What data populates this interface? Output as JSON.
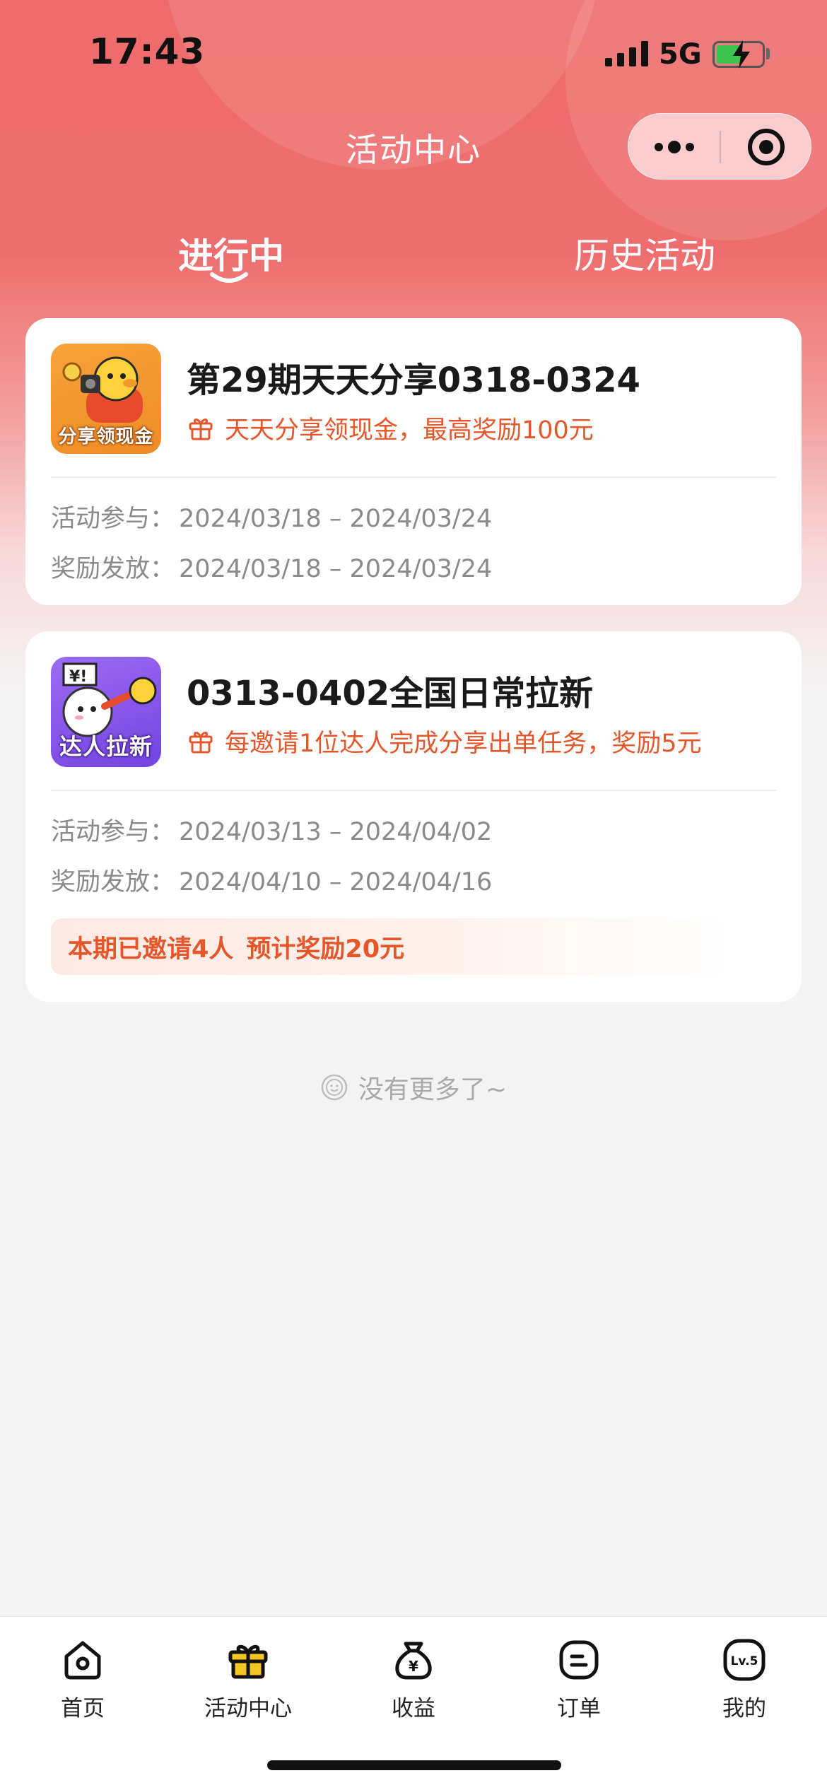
{
  "status_bar": {
    "time": "17:43",
    "network": "5G"
  },
  "nav": {
    "title": "活动中心"
  },
  "tabs": [
    {
      "label": "进行中",
      "active": true
    },
    {
      "label": "历史活动",
      "active": false
    }
  ],
  "activities": [
    {
      "thumb_label": "分享领现金",
      "title": "第29期天天分享0318-0324",
      "reward": "天天分享领现金，最高奖励100元",
      "participate_label": "活动参与：",
      "participate_range": "2024/03/18 – 2024/03/24",
      "payout_label": "奖励发放：",
      "payout_range": "2024/03/18 – 2024/03/24"
    },
    {
      "thumb_label": "达人拉新",
      "title": "0313-0402全国日常拉新",
      "reward": "每邀请1位达人完成分享出单任务，奖励5元",
      "participate_label": "活动参与：",
      "participate_range": "2024/03/13 – 2024/04/02",
      "payout_label": "奖励发放：",
      "payout_range": "2024/04/10 – 2024/04/16",
      "invited_text": "本期已邀请4人",
      "expected_text": "预计奖励20元"
    }
  ],
  "list_end_text": "没有更多了~",
  "tabbar": [
    {
      "label": "首页",
      "icon": "home-icon"
    },
    {
      "label": "活动中心",
      "icon": "gift-icon",
      "active": true
    },
    {
      "label": "收益",
      "icon": "money-bag-icon"
    },
    {
      "label": "订单",
      "icon": "order-icon"
    },
    {
      "label": "我的",
      "icon": "level-badge-icon",
      "badge_text": "Lv.5"
    }
  ],
  "colors": {
    "header_red": "#ee6b6c",
    "accent_orange": "#e5572b",
    "tab_active_yellow": "#f5c623"
  }
}
